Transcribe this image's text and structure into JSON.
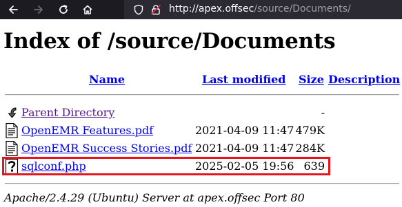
{
  "browser": {
    "url_host": "http://apex.offsec",
    "url_path": "/source/Documents/"
  },
  "page": {
    "title": "Index of /source/Documents"
  },
  "table": {
    "headers": {
      "name": "Name",
      "last_modified": "Last modified",
      "size": "Size",
      "description": "Description"
    },
    "rows": [
      {
        "name": "Parent Directory",
        "modified": "",
        "size": "-",
        "icon": "back-icon"
      },
      {
        "name": "OpenEMR Features.pdf",
        "modified": "2021-04-09 11:47",
        "size": "479K",
        "icon": "document-icon"
      },
      {
        "name": "OpenEMR Success Stories.pdf",
        "modified": "2021-04-09 11:47",
        "size": "284K",
        "icon": "document-icon"
      },
      {
        "name": "sqlconf.php",
        "modified": "2025-02-05 19:56",
        "size": "639",
        "icon": "unknown-file-icon"
      }
    ]
  },
  "footer": {
    "text": "Apache/2.4.29 (Ubuntu) Server at apex.offsec Port 80"
  },
  "colors": {
    "toolbar_bg": "#1c1b22",
    "urlbar_bg": "#2b2a33",
    "link": "#0000ee",
    "visited_link": "#551a8b",
    "highlight": "#e8141b"
  }
}
